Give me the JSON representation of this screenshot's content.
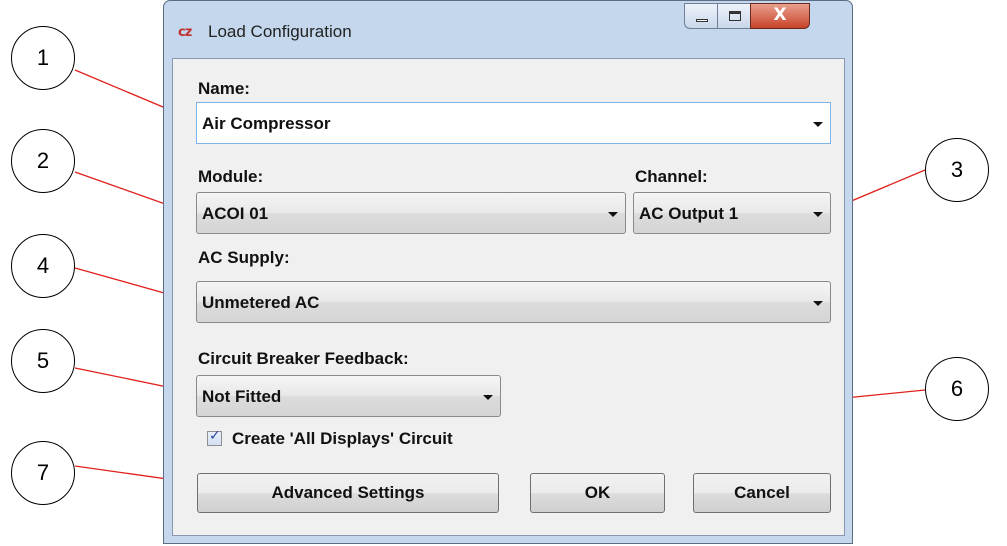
{
  "window": {
    "title": "Load Configuration",
    "app_icon_text": "cz",
    "close_glyph": "X"
  },
  "form": {
    "name_label": "Name:",
    "name_value": "Air Compressor",
    "module_label": "Module:",
    "module_value": "ACOI 01",
    "channel_label": "Channel:",
    "channel_value": "AC Output 1",
    "ac_supply_label": "AC Supply:",
    "ac_supply_value": "Unmetered AC",
    "breaker_label": "Circuit Breaker Feedback:",
    "breaker_value": "Not Fitted",
    "all_displays_label": "Create 'All Displays' Circuit",
    "all_displays_checked": true,
    "check_glyph": "✓"
  },
  "buttons": {
    "advanced": "Advanced Settings",
    "ok": "OK",
    "cancel": "Cancel"
  },
  "callouts": [
    "1",
    "2",
    "3",
    "4",
    "5",
    "6",
    "7"
  ],
  "colors": {
    "callout_arrow": "#e0201c",
    "window_frame": "#c4d7ed",
    "close_button": "#c7432a"
  }
}
